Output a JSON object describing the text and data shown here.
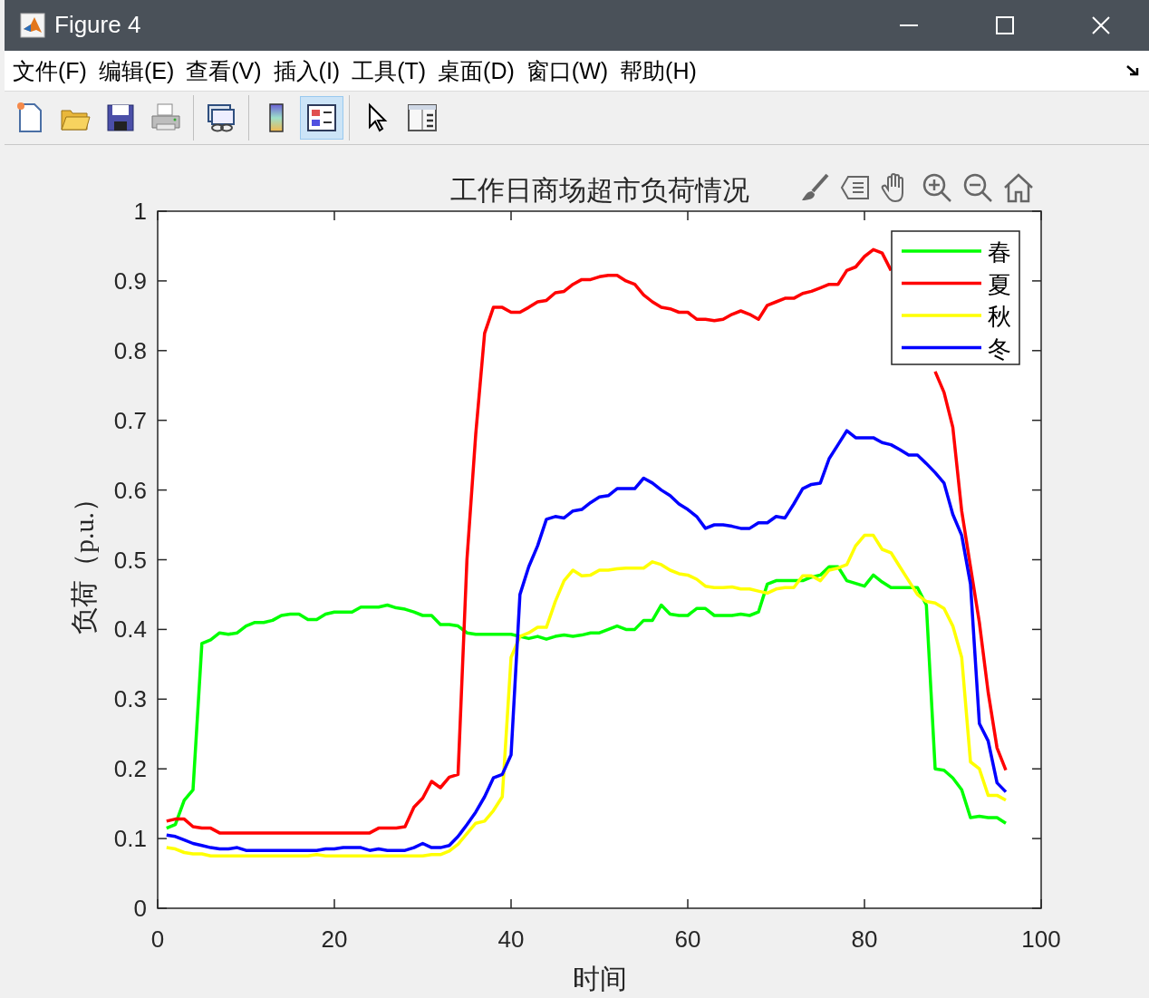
{
  "window": {
    "title": "Figure 4"
  },
  "menu": [
    "文件(F)",
    "编辑(E)",
    "查看(V)",
    "插入(I)",
    "工具(T)",
    "桌面(D)",
    "窗口(W)",
    "帮助(H)"
  ],
  "toolbar": {
    "groups": [
      {
        "buttons": [
          {
            "kind": "new",
            "selected": false
          },
          {
            "kind": "open",
            "selected": false
          },
          {
            "kind": "save",
            "selected": false
          },
          {
            "kind": "print",
            "selected": false
          }
        ]
      },
      {
        "buttons": [
          {
            "kind": "link",
            "selected": false
          }
        ]
      },
      {
        "buttons": [
          {
            "kind": "colorbar",
            "selected": false
          },
          {
            "kind": "legend",
            "selected": true
          }
        ]
      },
      {
        "buttons": [
          {
            "kind": "pointer",
            "selected": false
          },
          {
            "kind": "inspector",
            "selected": false
          }
        ]
      }
    ]
  },
  "axes_toolbar": [
    {
      "kind": "brush"
    },
    {
      "kind": "datatip"
    },
    {
      "kind": "pan"
    },
    {
      "kind": "zoomin"
    },
    {
      "kind": "zoomout"
    },
    {
      "kind": "home"
    }
  ],
  "chart_data": {
    "type": "line",
    "title": "工作日商场超市负荷情况",
    "xlabel": "时间",
    "ylabel": "负荷（p.u.）",
    "x": [
      1,
      2,
      3,
      4,
      5,
      6,
      7,
      8,
      9,
      10,
      11,
      12,
      13,
      14,
      15,
      16,
      17,
      18,
      19,
      20,
      21,
      22,
      23,
      24,
      25,
      26,
      27,
      28,
      29,
      30,
      31,
      32,
      33,
      34,
      35,
      36,
      37,
      38,
      39,
      40,
      41,
      42,
      43,
      44,
      45,
      46,
      47,
      48,
      49,
      50,
      51,
      52,
      53,
      54,
      55,
      56,
      57,
      58,
      59,
      60,
      61,
      62,
      63,
      64,
      65,
      66,
      67,
      68,
      69,
      70,
      71,
      72,
      73,
      74,
      75,
      76,
      77,
      78,
      79,
      80,
      81,
      82,
      83,
      84,
      85,
      86,
      87,
      88,
      89,
      90,
      91,
      92,
      93,
      94,
      95,
      96
    ],
    "legend": true,
    "xlim": [
      0,
      100
    ],
    "ylim": [
      0,
      1
    ],
    "xticks": [
      0,
      20,
      40,
      60,
      80,
      100
    ],
    "yticks": [
      0,
      0.1,
      0.2,
      0.3,
      0.4,
      0.5,
      0.6,
      0.7,
      0.8,
      0.9,
      1
    ],
    "series": [
      {
        "name": "春",
        "color": "#00ff00",
        "values": [
          0.115,
          0.12,
          0.155,
          0.17,
          0.38,
          0.385,
          0.395,
          0.393,
          0.395,
          0.405,
          0.41,
          0.41,
          0.413,
          0.42,
          0.422,
          0.422,
          0.414,
          0.414,
          0.422,
          0.425,
          0.425,
          0.425,
          0.432,
          0.432,
          0.432,
          0.435,
          0.431,
          0.429,
          0.425,
          0.42,
          0.42,
          0.407,
          0.407,
          0.405,
          0.395,
          0.393,
          0.393,
          0.393,
          0.393,
          0.393,
          0.39,
          0.387,
          0.39,
          0.386,
          0.39,
          0.392,
          0.39,
          0.392,
          0.395,
          0.395,
          0.4,
          0.405,
          0.4,
          0.4,
          0.413,
          0.413,
          0.435,
          0.422,
          0.42,
          0.42,
          0.43,
          0.43,
          0.42,
          0.42,
          0.42,
          0.422,
          0.42,
          0.425,
          0.465,
          0.47,
          0.47,
          0.47,
          0.47,
          0.475,
          0.478,
          0.49,
          0.49,
          0.47,
          0.466,
          0.462,
          0.478,
          0.468,
          0.46,
          0.46,
          0.46,
          0.46,
          0.435,
          0.2,
          0.198,
          0.187,
          0.17,
          0.13,
          0.132,
          0.13,
          0.13,
          0.122
        ]
      },
      {
        "name": "夏",
        "color": "#ff0000",
        "values": [
          0.125,
          0.128,
          0.128,
          0.117,
          0.115,
          0.115,
          0.108,
          0.108,
          0.108,
          0.108,
          0.108,
          0.108,
          0.108,
          0.108,
          0.108,
          0.108,
          0.108,
          0.108,
          0.108,
          0.108,
          0.108,
          0.108,
          0.108,
          0.108,
          0.115,
          0.115,
          0.115,
          0.117,
          0.145,
          0.158,
          0.182,
          0.173,
          0.188,
          0.192,
          0.5,
          0.68,
          0.825,
          0.862,
          0.862,
          0.855,
          0.855,
          0.862,
          0.87,
          0.872,
          0.883,
          0.885,
          0.895,
          0.902,
          0.902,
          0.906,
          0.908,
          0.908,
          0.9,
          0.895,
          0.88,
          0.87,
          0.862,
          0.86,
          0.855,
          0.855,
          0.845,
          0.845,
          0.843,
          0.845,
          0.852,
          0.857,
          0.852,
          0.845,
          0.865,
          0.87,
          0.875,
          0.875,
          0.882,
          0.885,
          0.89,
          0.895,
          0.895,
          0.915,
          0.92,
          0.935,
          0.945,
          0.94,
          0.915,
          null,
          null,
          null,
          null,
          0.77,
          0.74,
          0.69,
          0.57,
          0.49,
          0.41,
          0.31,
          0.23,
          0.198
        ]
      },
      {
        "name": "秋",
        "color": "#ffff00",
        "values": [
          0.087,
          0.085,
          0.08,
          0.078,
          0.078,
          0.075,
          0.075,
          0.075,
          0.075,
          0.075,
          0.075,
          0.075,
          0.075,
          0.075,
          0.075,
          0.075,
          0.075,
          0.077,
          0.075,
          0.075,
          0.075,
          0.075,
          0.075,
          0.075,
          0.075,
          0.075,
          0.075,
          0.075,
          0.075,
          0.075,
          0.077,
          0.077,
          0.082,
          0.092,
          0.107,
          0.122,
          0.125,
          0.14,
          0.16,
          0.36,
          0.39,
          0.395,
          0.403,
          0.403,
          0.44,
          0.47,
          0.485,
          0.477,
          0.478,
          0.485,
          0.485,
          0.487,
          0.488,
          0.488,
          0.488,
          0.497,
          0.493,
          0.485,
          0.48,
          0.478,
          0.472,
          0.462,
          0.46,
          0.46,
          0.461,
          0.458,
          0.458,
          0.455,
          0.452,
          0.458,
          0.46,
          0.46,
          0.477,
          0.477,
          0.47,
          0.485,
          0.488,
          0.493,
          0.52,
          0.535,
          0.535,
          0.515,
          0.51,
          0.49,
          0.47,
          0.45,
          0.44,
          0.438,
          0.43,
          0.405,
          0.36,
          0.21,
          0.2,
          0.162,
          0.162,
          0.155
        ]
      },
      {
        "name": "冬",
        "color": "#0000ff",
        "values": [
          0.105,
          0.103,
          0.098,
          0.093,
          0.09,
          0.087,
          0.085,
          0.085,
          0.087,
          0.083,
          0.083,
          0.083,
          0.083,
          0.083,
          0.083,
          0.083,
          0.083,
          0.083,
          0.085,
          0.085,
          0.087,
          0.087,
          0.087,
          0.083,
          0.085,
          0.083,
          0.083,
          0.083,
          0.087,
          0.093,
          0.087,
          0.087,
          0.09,
          0.103,
          0.12,
          0.138,
          0.16,
          0.187,
          0.192,
          0.22,
          0.45,
          0.49,
          0.52,
          0.558,
          0.562,
          0.56,
          0.57,
          0.572,
          0.582,
          0.59,
          0.592,
          0.602,
          0.602,
          0.602,
          0.617,
          0.61,
          0.6,
          0.592,
          0.58,
          0.572,
          0.562,
          0.545,
          0.55,
          0.55,
          0.548,
          0.545,
          0.545,
          0.553,
          0.553,
          0.562,
          0.56,
          0.58,
          0.602,
          0.608,
          0.61,
          0.645,
          0.665,
          0.685,
          0.675,
          0.675,
          0.675,
          0.668,
          0.665,
          0.658,
          0.65,
          0.65,
          0.638,
          0.625,
          0.61,
          0.565,
          0.535,
          0.465,
          0.265,
          0.24,
          0.18,
          0.167
        ]
      }
    ]
  }
}
